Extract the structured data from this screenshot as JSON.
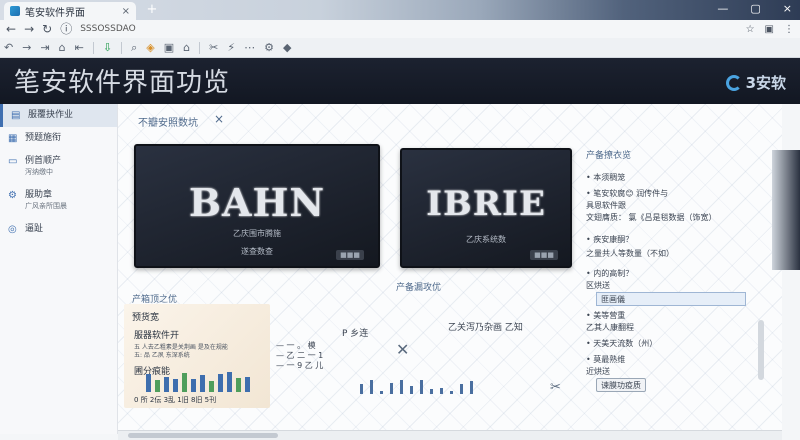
{
  "browser": {
    "tab_title": "笔安软件界面",
    "tab_close": "×",
    "new_tab": "+",
    "url": "SSSOSSDAO",
    "window_controls": [
      "—",
      "▢",
      "×"
    ]
  },
  "banner": {
    "title": "笔安软件界面功览",
    "logo_text": "3安软"
  },
  "sidebar": {
    "items": [
      {
        "label": "服覆抉作业",
        "sub": ""
      },
      {
        "label": "预题施衔",
        "sub": ""
      },
      {
        "label": "例首顺产",
        "sub": "泻纳缴中"
      },
      {
        "label": "服助章",
        "sub": "广风亲所围晨"
      },
      {
        "label": "逼趾",
        "sub": ""
      }
    ]
  },
  "main": {
    "section_title": "不瓣安照数坑",
    "close_label": "×",
    "card1": {
      "big": "BAHN",
      "cap1": "乙庆围市腾施",
      "cap2": "遂查数查",
      "tag": "■■■"
    },
    "card2": {
      "big": "IBRIE",
      "cap1": "乙庆系统数",
      "tag": "■■■"
    },
    "right_panel": {
      "title": "产备撩衣览",
      "rows": [
        "• 本须稠笼",
        "• 笔安软腐😊 润传件与",
        "  具恩软件跟",
        "  文翅膺质：  氯《吕是毯数据（饰宽）",
        "• 疾安康酮？",
        "  之量共人等数量（不如）",
        "• 内的高制？",
        "  区烘送",
        "• 美等营重",
        "  乙其人康翻程",
        "• 天美天流数（州）",
        "• 莫最熟维",
        "  近烘送"
      ],
      "input_value": "匪画儀",
      "button": "谏膜功疫质"
    },
    "lower_title": "产箱顶之优",
    "preview": {
      "heading": "预货宽",
      "sub": "服器软件开",
      "lines": [
        "五 人去乙粗素是关荆画 是及在规能",
        "五: 品 乙夙 东深系统"
      ],
      "chart_title": "圃分痕能",
      "ticks": "0 所 2伝 3乱 1旧 8旧 5刊"
    },
    "middle": {
      "l1": "—  一 。 模",
      "l2": "— 乙 二 一 1",
      "l3": "— 一 9 乙 儿",
      "center": "P 乡连",
      "mid_title": "产备漏攻优",
      "mid_text": "乙关泻乃杂画 乙知"
    },
    "preview_bars": [
      0.8,
      0.55,
      0.7,
      0.6,
      0.85,
      0.6,
      0.75,
      0.5,
      0.8,
      0.9,
      0.65,
      0.7
    ],
    "strip_bars": [
      0.6,
      0.9,
      0.2,
      0.7,
      0.9,
      0.5,
      0.9,
      0.3,
      0.4,
      0.2,
      0.6,
      0.8
    ]
  },
  "toolbar": {
    "icons": [
      "↶",
      "→",
      "⇥",
      "⌂",
      "⇤",
      "⇩",
      "⌕",
      "◈",
      "▣",
      "⌂",
      "✂",
      "⚡",
      "⋯",
      "⚙",
      "◆"
    ]
  }
}
